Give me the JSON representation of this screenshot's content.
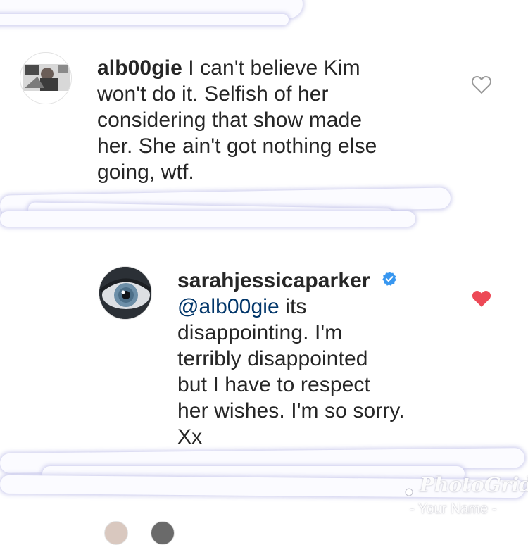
{
  "comments": [
    {
      "username": "alb00gie",
      "text_line1": " I can't believe Kim",
      "text_line2": "won't do it. Selfish of her",
      "text_line3": "considering that show made",
      "text_line4": "her. She ain't got nothing else",
      "text_line5": "going, wtf.",
      "liked": false,
      "heart_color": "#999999"
    },
    {
      "username": "sarahjessicaparker",
      "verified": true,
      "mention": "@alb00gie",
      "text_line1": " its",
      "text_line2": "disappointing. I'm",
      "text_line3": "terribly disappointed",
      "text_line4": "but I have to respect",
      "text_line5": "her wishes. I'm so sorry.",
      "text_line6": "Xx",
      "liked": true,
      "heart_color": "#ed4956",
      "verified_color": "#3897f0"
    }
  ],
  "watermark": {
    "brand": "PhotoGrid",
    "sub": "- Your Name -"
  }
}
